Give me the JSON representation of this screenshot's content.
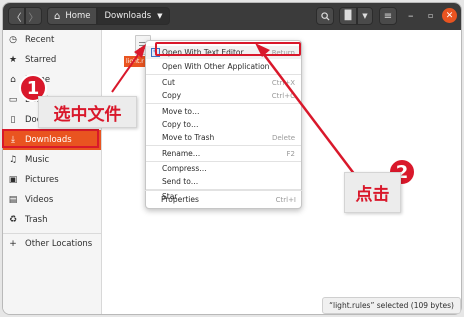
{
  "header": {
    "back_icon": "back-chevron-icon",
    "forward_icon": "forward-chevron-icon",
    "breadcrumb": [
      {
        "label": "Home",
        "icon": "home-icon"
      },
      {
        "label": "Downloads",
        "icon": "chevron-down-icon"
      }
    ],
    "toolbar_icons": [
      "search-icon",
      "view-toggle-icon",
      "view-options-chevron-icon",
      "menu-icon"
    ],
    "window_controls": [
      "minimize-icon",
      "maximize-icon",
      "close-icon"
    ]
  },
  "sidebar": {
    "items": [
      {
        "label": "Recent",
        "icon": "clock-icon",
        "glyph": "🕓"
      },
      {
        "label": "Starred",
        "icon": "star-icon",
        "glyph": "★"
      },
      {
        "label": "Home",
        "icon": "home-icon",
        "glyph": "⌂"
      },
      {
        "label": "Desktop",
        "icon": "desktop-icon",
        "glyph": "▭"
      },
      {
        "label": "Documents",
        "icon": "document-icon",
        "glyph": "▯"
      },
      {
        "label": "Downloads",
        "icon": "download-icon",
        "glyph": "⤓",
        "active": true
      },
      {
        "label": "Music",
        "icon": "music-icon",
        "glyph": "♫"
      },
      {
        "label": "Pictures",
        "icon": "picture-icon",
        "glyph": "▣"
      },
      {
        "label": "Videos",
        "icon": "video-icon",
        "glyph": "▤"
      },
      {
        "label": "Trash",
        "icon": "trash-icon",
        "glyph": "🗑"
      }
    ],
    "other_locations": {
      "label": "Other Locations",
      "icon": "plus-icon",
      "glyph": "+"
    }
  },
  "file": {
    "name": "light.rules",
    "label_visible": "light.r"
  },
  "context_menu": {
    "items": [
      {
        "label": "Open With Text Editor",
        "shortcut": "Return",
        "icon": "text-editor-icon"
      },
      {
        "label": "Open With Other Application",
        "shortcut": ""
      },
      {
        "label": "Cut",
        "shortcut": "Ctrl+X"
      },
      {
        "label": "Copy",
        "shortcut": "Ctrl+C"
      },
      {
        "label": "Move to…",
        "shortcut": ""
      },
      {
        "label": "Copy to…",
        "shortcut": ""
      },
      {
        "label": "Move to Trash",
        "shortcut": "Delete"
      },
      {
        "label": "Rename…",
        "shortcut": "F2"
      },
      {
        "label": "Compress…",
        "shortcut": ""
      },
      {
        "label": "Send to…",
        "shortcut": ""
      },
      {
        "label": "Star",
        "shortcut": ""
      },
      {
        "label": "Properties",
        "shortcut": "Ctrl+I"
      }
    ]
  },
  "annotations": {
    "step1_number": "1",
    "step1_text": "选中文件",
    "step2_number": "2",
    "step2_text": "点击",
    "accent_color": "#d9182b"
  },
  "status_bar": {
    "text": "“light.rules” selected  (109 bytes)"
  },
  "colors": {
    "accent": "#e95420",
    "headerbar": "#3b3b3b",
    "annotation_red": "#d9182b"
  }
}
